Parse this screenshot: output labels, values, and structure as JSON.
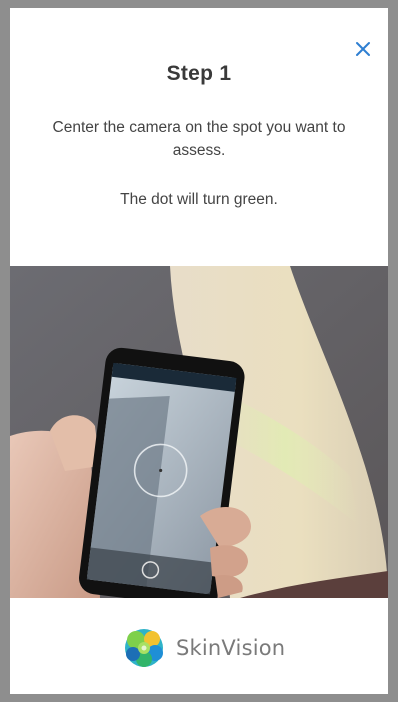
{
  "onboarding": {
    "title": "Step 1",
    "instruction_line1": "Center the camera on the spot you want to assess.",
    "instruction_line2": "The dot will turn green.",
    "close_icon": "close-icon",
    "image": "hand holding phone camera over arm"
  },
  "brand": {
    "name": "SkinVision",
    "logo_icon": "skinvision-logo-icon"
  },
  "colors": {
    "accent": "#2f7fd1",
    "title": "#3a3a3a",
    "body_text": "#444444",
    "brand_text": "#7a7a7a"
  }
}
